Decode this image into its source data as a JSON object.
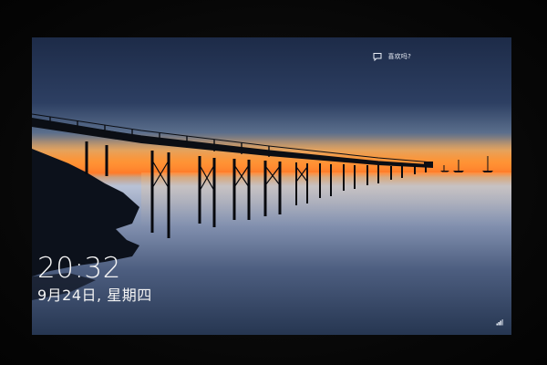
{
  "lockscreen": {
    "time": "20:32",
    "date": "9月24日, 星期四"
  },
  "tray": {
    "spotlight_label": "喜欢吗?",
    "spotlight_icon": "chat-bubble-icon",
    "network_icon": "network-status-icon"
  },
  "colors": {
    "sky_top": "#1b2c4a",
    "horizon_glow": "#ff7a24",
    "water": "#3a4b6c",
    "text": "#f4f4f4"
  }
}
